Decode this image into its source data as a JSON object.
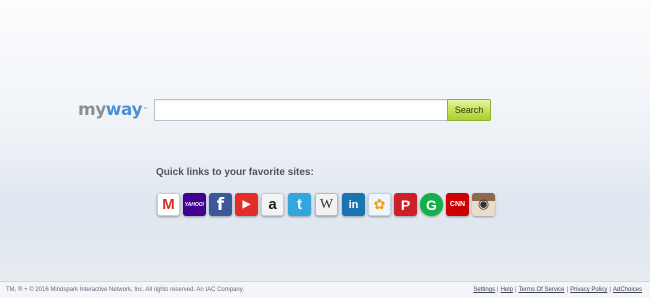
{
  "logo": {
    "my": "my",
    "way": "way",
    "tm": "™"
  },
  "search": {
    "value": "",
    "placeholder": "",
    "button_label": "Search"
  },
  "quick_links": {
    "title": "Quick links to your favorite sites:",
    "items": [
      {
        "name": "Gmail",
        "glyph": "M",
        "icon": "gmail-icon",
        "color": "#d93025"
      },
      {
        "name": "Yahoo",
        "glyph": "YAHOO!",
        "icon": "yahoo-icon",
        "color": "#400090"
      },
      {
        "name": "Facebook",
        "glyph": "f",
        "icon": "facebook-icon",
        "color": "#3b5998"
      },
      {
        "name": "YouTube",
        "glyph": "▶",
        "icon": "youtube-icon",
        "color": "#e52d27"
      },
      {
        "name": "Amazon",
        "glyph": "a",
        "icon": "amazon-icon",
        "color": "#f3f3f3"
      },
      {
        "name": "Twitter",
        "glyph": "t",
        "icon": "twitter-icon",
        "color": "#33a6e0"
      },
      {
        "name": "Wikipedia",
        "glyph": "W",
        "icon": "wikipedia-icon",
        "color": "#f2f2f2"
      },
      {
        "name": "LinkedIn",
        "glyph": "in",
        "icon": "linkedin-icon",
        "color": "#1a74b2"
      },
      {
        "name": "MSN",
        "glyph": "✿",
        "icon": "msn-icon",
        "color": "#eef4fb"
      },
      {
        "name": "Pinterest",
        "glyph": "P",
        "icon": "pinterest-icon",
        "color": "#cb2027"
      },
      {
        "name": "Grammarly",
        "glyph": "G",
        "icon": "g-icon",
        "color": "#15b04c"
      },
      {
        "name": "CNN",
        "glyph": "CNN",
        "icon": "cnn-icon",
        "color": "#cc0000"
      },
      {
        "name": "Instagram",
        "glyph": "◉",
        "icon": "instagram-icon",
        "color": "#9b7a5e"
      }
    ]
  },
  "footer": {
    "copyright": "TM, ® + © 2016 Mindspark Interactive Network, Inc. All rights reserved. An IAC Company.",
    "links": [
      "Settings",
      "Help",
      "Terms Of Service",
      "Privacy Policy",
      "AdChoices"
    ]
  }
}
